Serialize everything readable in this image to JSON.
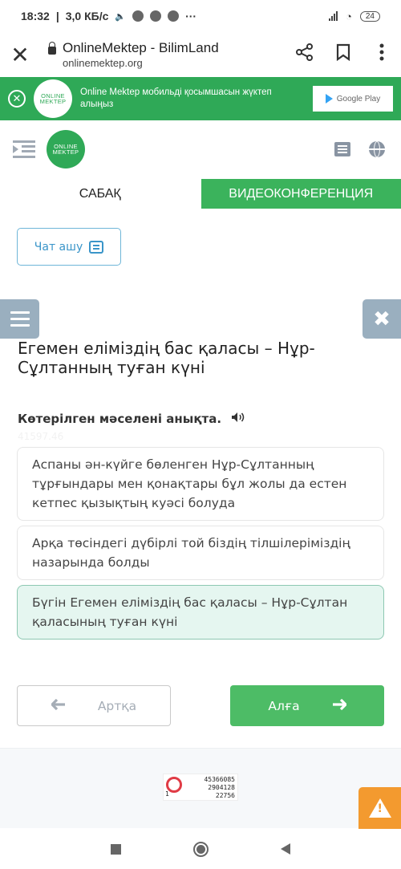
{
  "status_bar": {
    "time": "18:32",
    "speed": "3,0 КБ/с",
    "battery": "24",
    "icons": [
      "volume-icon",
      "chrome-icon",
      "chrome-icon",
      "vpn-icon",
      "more-icon",
      "signal-icon",
      "wifi-icon",
      "battery-icon"
    ]
  },
  "browser": {
    "title": "OnlineMektep - BilimLand",
    "url": "onlinemektep.org",
    "close_glyph": "✕",
    "share_glyph": "⋖",
    "bookmark_glyph": "🔖",
    "menu_glyph": "⋮"
  },
  "app_banner": {
    "logo_line1": "ONLINE",
    "logo_line2": "MEKTEP",
    "text": "Online Mektep мобильді қосымшасын жүктеп алыңыз",
    "store_label": "Google Play",
    "brand_color": "#2fa957"
  },
  "site_header": {
    "logo_line1": "ONLINE",
    "logo_line2": "MEKTEP"
  },
  "tabs": [
    {
      "label": "САБАҚ",
      "active": false
    },
    {
      "label": "ВИДЕОКОНФЕРЕНЦИЯ",
      "active": true
    }
  ],
  "chat": {
    "label": "Чат ашу"
  },
  "side": {
    "close_glyph": "✖"
  },
  "lesson": {
    "title": "Егемен еліміздің бас қаласы – Нұр-Сұлтанның туған күні",
    "question": "Көтерілген мәселені анықта.",
    "question_id": "41597.46",
    "speaker_glyph": "🔊",
    "answers": [
      {
        "text": "Аспаны ән-күйге бөленген Нұр-Сұлтанның тұрғындары мен қонақтары бұл жолы да естен кетпес қызықтың куәсі болуда",
        "selected": false
      },
      {
        "text": "Арқа төсіндегі дүбірлі той біздің тілшілеріміздің назарында болды",
        "selected": false
      },
      {
        "text": "Бүгін Егемен еліміздің бас қаласы – Нұр-Сұлтан қаласының туған күні",
        "selected": true
      }
    ]
  },
  "navigation": {
    "back_label": "Артқа",
    "next_label": "Алға",
    "back_arrow": "🡐",
    "next_arrow": "➜",
    "accent_color": "#4dbc66"
  },
  "counter": {
    "line1": "45366085",
    "line2": "2904128",
    "line3": "22756",
    "corner": "1"
  }
}
